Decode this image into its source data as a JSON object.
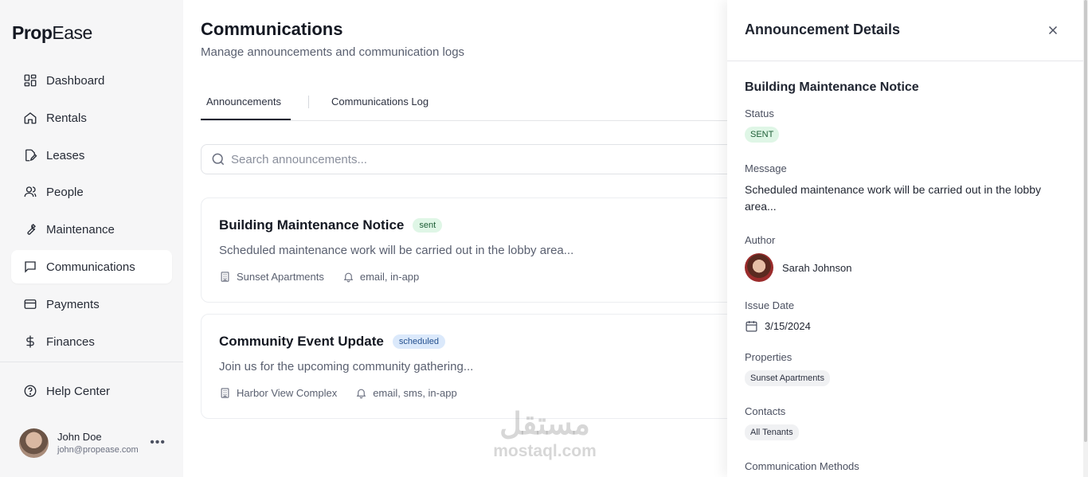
{
  "app": {
    "logo_bold": "Prop",
    "logo_light": "Ease"
  },
  "sidebar": {
    "items": [
      {
        "label": "Dashboard",
        "icon": "dashboard-icon"
      },
      {
        "label": "Rentals",
        "icon": "home-icon"
      },
      {
        "label": "Leases",
        "icon": "document-edit-icon"
      },
      {
        "label": "People",
        "icon": "users-icon"
      },
      {
        "label": "Maintenance",
        "icon": "wrench-icon"
      },
      {
        "label": "Communications",
        "icon": "message-icon",
        "active": true
      },
      {
        "label": "Payments",
        "icon": "credit-card-icon"
      },
      {
        "label": "Finances",
        "icon": "dollar-icon"
      }
    ],
    "help": {
      "label": "Help Center",
      "icon": "help-icon"
    },
    "user": {
      "name": "John Doe",
      "email": "john@propease.com"
    }
  },
  "main": {
    "title": "Communications",
    "subtitle": "Manage announcements and communication logs",
    "tabs": [
      {
        "label": "Announcements",
        "active": true
      },
      {
        "label": "Communications Log",
        "active": false
      }
    ],
    "search": {
      "placeholder": "Search announcements...",
      "value": ""
    },
    "announcements": [
      {
        "title": "Building Maintenance Notice",
        "status": "sent",
        "description": "Scheduled maintenance work will be carried out in the lobby area...",
        "property": "Sunset Apartments",
        "channels": "email, in-app"
      },
      {
        "title": "Community Event Update",
        "status": "scheduled",
        "description": "Join us for the upcoming community gathering...",
        "property": "Harbor View Complex",
        "channels": "email, sms, in-app"
      }
    ]
  },
  "panel": {
    "title": "Announcement Details",
    "heading": "Building Maintenance Notice",
    "status_label": "Status",
    "status_value": "SENT",
    "message_label": "Message",
    "message": "Scheduled maintenance work will be carried out in the lobby area...",
    "author_label": "Author",
    "author_name": "Sarah Johnson",
    "issue_date_label": "Issue Date",
    "issue_date": "3/15/2024",
    "properties_label": "Properties",
    "property_chip": "Sunset Apartments",
    "contacts_label": "Contacts",
    "contacts_chip": "All Tenants",
    "methods_label": "Communication Methods"
  },
  "watermark": {
    "arabic": "مستقل",
    "latin": "mostaql.com"
  },
  "colors": {
    "sent_bg": "#dff6e6",
    "scheduled_bg": "#dbe9fb",
    "sidebar_bg": "#f6f6f7"
  }
}
